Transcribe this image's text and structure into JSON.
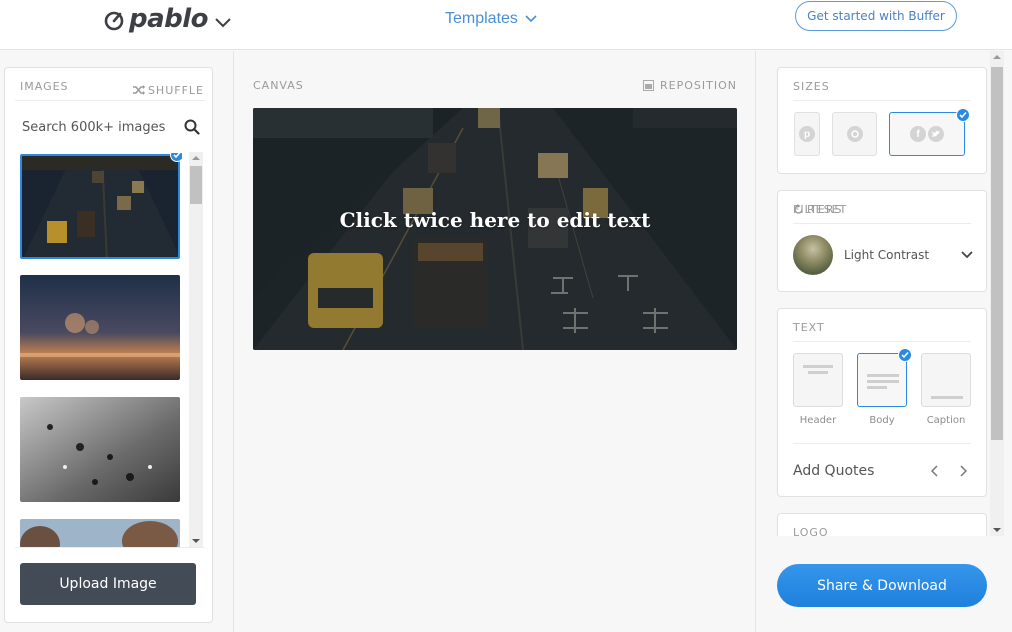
{
  "header": {
    "logo_text": "pablo",
    "templates_label": "Templates",
    "get_started_label": "Get started with Buffer"
  },
  "images_panel": {
    "title": "IMAGES",
    "shuffle_label": "SHUFFLE",
    "search_placeholder": "Search 600k+ images",
    "thumbnails": [
      {
        "description": "night traffic highway",
        "selected": true
      },
      {
        "description": "street lights at dusk",
        "selected": false
      },
      {
        "description": "water droplets on glass",
        "selected": false
      },
      {
        "description": "trees and sky",
        "selected": false
      }
    ],
    "upload_label": "Upload Image"
  },
  "canvas": {
    "title": "CANVAS",
    "reposition_label": "REPOSITION",
    "overlay_text": "Click twice here to edit text"
  },
  "sizes": {
    "title": "SIZES",
    "options": [
      {
        "name": "pinterest",
        "icon": "pinterest-icon",
        "selected": false
      },
      {
        "name": "instagram",
        "icon": "instagram-icon",
        "selected": false
      },
      {
        "name": "facebook-twitter",
        "icon": "facebook-twitter-icon",
        "selected": true
      }
    ]
  },
  "filters": {
    "title": "FILTERS",
    "reset_label": "RESET",
    "selected_filter": "Light Contrast"
  },
  "text": {
    "title": "TEXT",
    "options": [
      {
        "label": "Header",
        "selected": false
      },
      {
        "label": "Body",
        "selected": true
      },
      {
        "label": "Caption",
        "selected": false
      }
    ],
    "add_quotes_label": "Add Quotes"
  },
  "logo_section": {
    "title": "LOGO"
  },
  "share_download_label": "Share & Download",
  "colors": {
    "accent": "#2a8ae0",
    "upload_button": "#434c56",
    "templates_link": "#4a8fd6"
  }
}
